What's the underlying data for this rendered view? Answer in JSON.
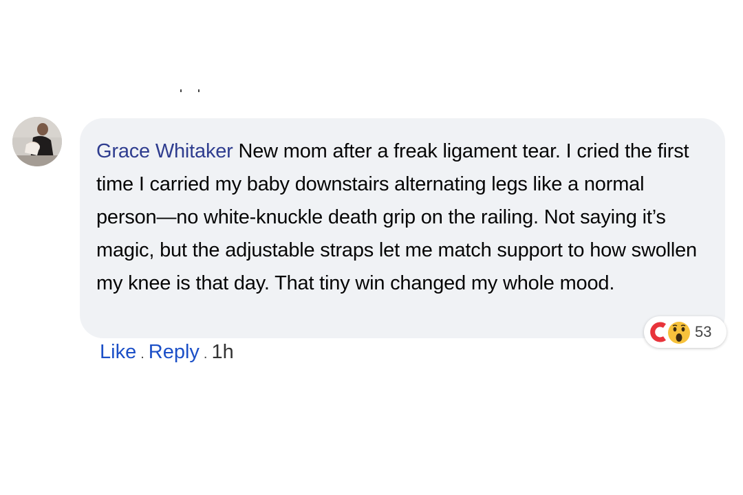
{
  "comment": {
    "author": "Grace Whitaker",
    "text": "New mom after a freak ligament tear. I cried the first time I carried my baby downstairs alternating legs like a normal person—no white-knuckle death grip on the railing. Not saying it’s magic, but the adjustable straps let me match support to how swollen my knee is that day. That tiny win changed my whole mood."
  },
  "reactions": {
    "count": "53",
    "icons": [
      "care-icon",
      "wow-icon"
    ]
  },
  "actions": {
    "like_label": "Like",
    "separator": ".",
    "reply_label": "Reply",
    "timestamp": "1h"
  },
  "colors": {
    "author": "#2f3d8f",
    "link": "#1b4fc7",
    "bubble": "#f0f2f5",
    "care": "#e8343b",
    "wow": "#f7c23c"
  }
}
